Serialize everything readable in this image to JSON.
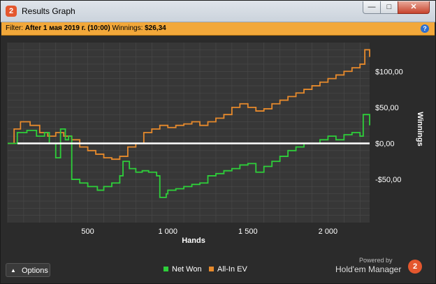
{
  "window": {
    "title": "Results Graph",
    "app_icon": "2",
    "buttons": {
      "minimize": "—",
      "maximize": "□",
      "close": "✕"
    }
  },
  "filter": {
    "label": "Filter:",
    "value": "After 1 мая 2019 г. (10:00)",
    "winnings_label": "Winnings:",
    "winnings_value": "$26,34",
    "help_icon": "?"
  },
  "colors": {
    "net_won": "#2ecf3a",
    "all_in_ev": "#e78a2c",
    "zero_line": "#ffffff",
    "grid": "#4a4a4a",
    "plot_bg": "#373737"
  },
  "chart_data": {
    "type": "line",
    "xlabel": "Hands",
    "ylabel": "Winnings",
    "xlim": [
      0,
      2260
    ],
    "ylim": [
      -110,
      140
    ],
    "x_ticks": [
      500,
      1000,
      1500,
      2000
    ],
    "x_tick_labels": [
      "500",
      "1 000",
      "1 500",
      "2 000"
    ],
    "y_ticks": [
      100,
      50,
      0,
      -50
    ],
    "y_tick_labels": [
      "$100,00",
      "$50,00",
      "$0,00",
      "-$50,00"
    ],
    "grid": true,
    "legend_position": "bottom-center",
    "series": [
      {
        "name": "Net Won",
        "x": [
          0,
          60,
          120,
          180,
          230,
          260,
          300,
          330,
          360,
          380,
          400,
          450,
          500,
          560,
          600,
          650,
          700,
          720,
          760,
          800,
          840,
          880,
          930,
          950,
          990,
          1000,
          1050,
          1100,
          1150,
          1200,
          1250,
          1300,
          1350,
          1400,
          1450,
          1500,
          1550,
          1600,
          1650,
          1700,
          1750,
          1800,
          1850,
          1900,
          1950,
          2000,
          2050,
          2100,
          2150,
          2200,
          2220,
          2260
        ],
        "y": [
          0,
          15,
          18,
          10,
          15,
          0,
          -20,
          20,
          5,
          10,
          -50,
          -55,
          -60,
          -65,
          -60,
          -55,
          -45,
          -25,
          -35,
          -40,
          -38,
          -40,
          -45,
          -75,
          -70,
          -65,
          -63,
          -60,
          -57,
          -55,
          -45,
          -42,
          -38,
          -35,
          -30,
          -28,
          -40,
          -32,
          -25,
          -18,
          -10,
          -5,
          0,
          0,
          5,
          10,
          5,
          12,
          15,
          10,
          40,
          25
        ]
      },
      {
        "name": "All-In EV",
        "x": [
          0,
          40,
          80,
          140,
          200,
          250,
          300,
          350,
          400,
          450,
          500,
          550,
          600,
          650,
          700,
          750,
          800,
          850,
          900,
          950,
          1000,
          1050,
          1100,
          1150,
          1200,
          1250,
          1300,
          1350,
          1400,
          1450,
          1500,
          1550,
          1600,
          1650,
          1700,
          1750,
          1800,
          1850,
          1900,
          1950,
          2000,
          2050,
          2100,
          2150,
          2200,
          2230,
          2260
        ],
        "y": [
          0,
          20,
          30,
          25,
          15,
          10,
          15,
          10,
          5,
          -5,
          -10,
          -15,
          -20,
          -22,
          -18,
          -5,
          0,
          15,
          20,
          25,
          22,
          25,
          27,
          30,
          25,
          30,
          35,
          40,
          50,
          55,
          50,
          45,
          48,
          55,
          60,
          65,
          70,
          75,
          80,
          85,
          90,
          95,
          100,
          105,
          110,
          130,
          120
        ]
      }
    ]
  },
  "bottom": {
    "options_label": "Options",
    "options_icon": "chevron-up-icon",
    "legend": [
      {
        "label": "Net Won",
        "color": "#2ecf3a"
      },
      {
        "label": "All-In EV",
        "color": "#e78a2c"
      }
    ],
    "powered_by": "Powered by",
    "brand": "Hold'em Manager",
    "brand_logo": "2"
  }
}
